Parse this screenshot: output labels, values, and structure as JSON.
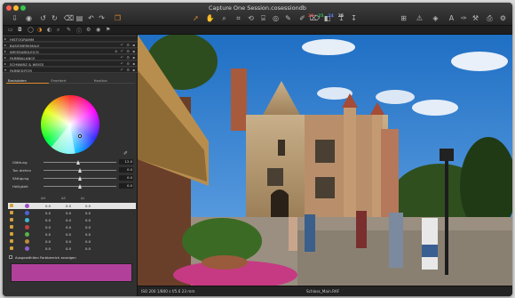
{
  "window": {
    "title": "Capture One Session.cosessiondb",
    "traffic_colors": [
      "#fc5f57",
      "#fdbc2e",
      "#34c84a"
    ]
  },
  "toolbar": {
    "left_icons": [
      "import-icon",
      "camera-icon",
      "rotate-left-icon",
      "rotate-right-icon",
      "trash-icon",
      "delete-icon",
      "undo-icon",
      "redo-icon",
      "variant-icon"
    ],
    "center_icons": [
      "cursor-icon",
      "pan-icon",
      "zoom-icon",
      "crop-icon",
      "rotate-icon",
      "keystone-icon",
      "spot-icon",
      "picker-icon",
      "brush-icon",
      "eraser-icon",
      "gradient-icon",
      "copy-icon",
      "apply-icon"
    ],
    "right_icons": [
      "grid-view-icon",
      "exposure-warning-icon",
      "focus-mask-icon",
      "text-overlay-icon",
      "edit-icon",
      "tools-icon",
      "print-icon",
      "settings-icon"
    ],
    "counts": [
      {
        "value": "25",
        "color": "#e04545"
      },
      {
        "value": "25",
        "color": "#2fbf4a"
      },
      {
        "value": "24",
        "color": "#5a7dff"
      },
      {
        "value": "25",
        "color": "#d0d0d0"
      }
    ],
    "tab_icons": [
      "folder-icon",
      "camera-tab-icon",
      "lens-icon",
      "color-tab-icon",
      "exposure-tab-icon",
      "detail-tab-icon",
      "adjustments-tab-icon",
      "metadata-tab-icon",
      "output-tab-icon",
      "batch-tab-icon",
      "quick-tab-icon"
    ]
  },
  "tool_sections": [
    {
      "label": "HISTOGRAMM",
      "arrow": "▸",
      "controls": ""
    },
    {
      "label": "BASISMERKMALE",
      "arrow": "▸",
      "controls": "↶ ⚙ ▪"
    },
    {
      "label": "WEISSABGLEICH",
      "arrow": "▸",
      "controls": "⊕ ↶ ⚙ ▪"
    },
    {
      "label": "FARBBALANCE",
      "arrow": "▸",
      "controls": "↶ ⚙ ▪"
    },
    {
      "label": "SCHWARZ & WEISS",
      "arrow": "▸",
      "controls": "↶ ⚙ ▪"
    },
    {
      "label": "FARBEDITOR",
      "arrow": "▾",
      "controls": "↶ ⚙ ▪"
    }
  ],
  "color_editor": {
    "tabs": [
      {
        "label": "Basisdaten",
        "active": true
      },
      {
        "label": "Erweitert",
        "active": false
      },
      {
        "label": "Hautton",
        "active": false
      }
    ],
    "sliders": [
      {
        "label": "Glättung",
        "value": "12.0",
        "pos": 0.45
      },
      {
        "label": "Ton drehen",
        "value": "0.0",
        "pos": 0.5
      },
      {
        "label": "Sättigung",
        "value": "0.0",
        "pos": 0.5
      },
      {
        "label": "Helligkeit",
        "value": "0.0",
        "pos": 0.5
      }
    ],
    "columns": [
      "ΔH",
      "ΔS",
      "ΔL"
    ],
    "rows": [
      {
        "color": "#a24bc8",
        "dh": "0.0",
        "ds": "0.0",
        "dl": "0.0",
        "checked": true,
        "selected": true
      },
      {
        "color": "#4a64d6",
        "dh": "0.0",
        "ds": "0.0",
        "dl": "0.0",
        "checked": true,
        "selected": false
      },
      {
        "color": "#3fb8d0",
        "dh": "0.0",
        "ds": "0.0",
        "dl": "0.0",
        "checked": true,
        "selected": false
      },
      {
        "color": "#c24040",
        "dh": "0.0",
        "ds": "0.0",
        "dl": "0.0",
        "checked": true,
        "selected": false
      },
      {
        "color": "#58b448",
        "dh": "0.0",
        "ds": "0.0",
        "dl": "0.0",
        "checked": true,
        "selected": false
      },
      {
        "color": "#c28a3a",
        "dh": "0.0",
        "ds": "0.0",
        "dl": "0.0",
        "checked": true,
        "selected": false
      },
      {
        "color": "#8f5fd0",
        "dh": "0.0",
        "ds": "0.0",
        "dl": "0.0",
        "checked": true,
        "selected": false
      }
    ],
    "show_selected_label": "Ausgewählten Farbbereich anzeigen",
    "swatch_color": "#b1409b"
  },
  "status": {
    "meta": "ISO 200    1/800 s    f/5.6    23 mm",
    "filename": "Schloss_Main.RAF"
  }
}
